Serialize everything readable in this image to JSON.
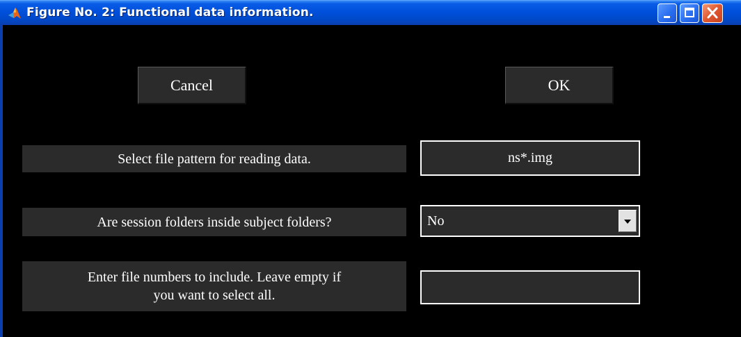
{
  "window": {
    "title": "Figure No. 2: Functional data information.",
    "icons": [
      "matlab-icon",
      "minimize-icon",
      "maximize-icon",
      "close-icon"
    ],
    "colors": {
      "titlebar": "#0050dc",
      "background": "#000000",
      "control": "#2b2b2b",
      "text": "#ffffff"
    }
  },
  "buttons": {
    "cancel_label": "Cancel",
    "ok_label": "OK"
  },
  "fields": {
    "file_pattern": {
      "label": "Select file pattern for reading data.",
      "value": "ns*.img"
    },
    "session_folders": {
      "label": "Are session folders inside subject folders?",
      "selected": "No"
    },
    "file_numbers": {
      "label_line1": "Enter file numbers to include. Leave empty if",
      "label_line2": "you want to select all.",
      "value": ""
    }
  }
}
